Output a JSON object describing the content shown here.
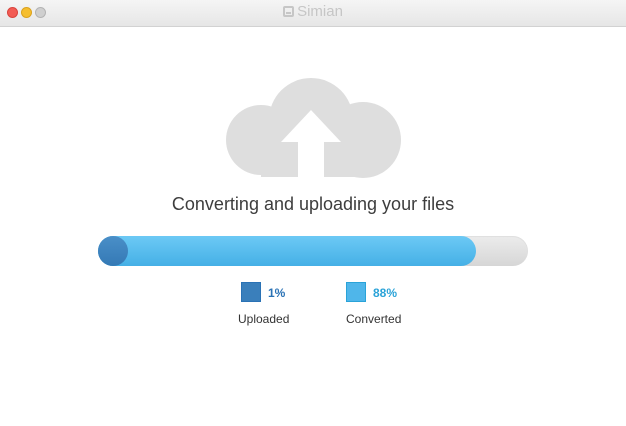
{
  "window": {
    "app_name": "Simian"
  },
  "main": {
    "headline": "Converting and uploading your files",
    "progress": {
      "uploaded_percent": 1,
      "converted_percent": 88
    },
    "legend": [
      {
        "label": "Uploaded",
        "value": "1%",
        "color": "#3a7fbb",
        "text_color": "#2a72b5"
      },
      {
        "label": "Converted",
        "value": "88%",
        "color": "#4fb6ea",
        "text_color": "#2aa3d8"
      }
    ]
  },
  "icons": {
    "window_logo": "simian-logo-icon",
    "hero": "cloud-upload-icon"
  },
  "colors": {
    "track": "#dcdcdc",
    "cloud": "#dedede",
    "arrow": "#ffffff"
  }
}
